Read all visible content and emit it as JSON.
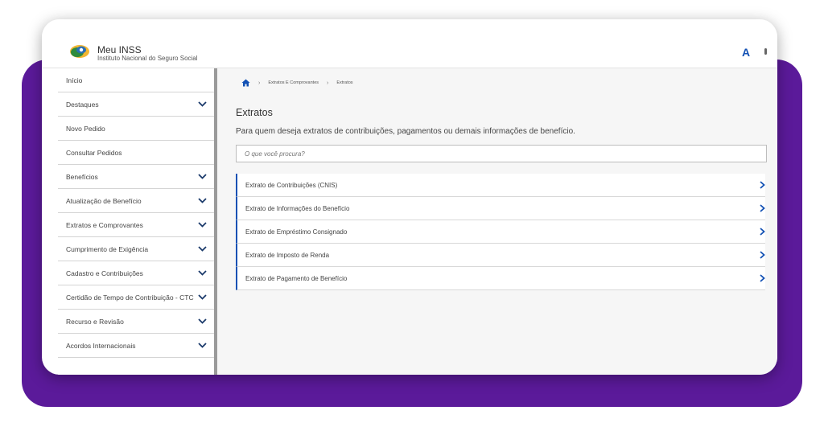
{
  "app": {
    "title": "Meu INSS",
    "subtitle": "Instituto Nacional do Seguro Social",
    "font_size_button": "A"
  },
  "colors": {
    "accent": "#1351b4",
    "frame_background": "#5b1a9a",
    "content_background": "#f6f6f6"
  },
  "sidebar": {
    "items": [
      {
        "label": "Início",
        "chevron": false
      },
      {
        "label": "Destaques",
        "chevron": true
      },
      {
        "label": "Novo Pedido",
        "chevron": false
      },
      {
        "label": "Consultar Pedidos",
        "chevron": false
      },
      {
        "label": "Benefícios",
        "chevron": true
      },
      {
        "label": "Atualização de Benefício",
        "chevron": true
      },
      {
        "label": "Extratos e Comprovantes",
        "chevron": true
      },
      {
        "label": "Cumprimento de Exigência",
        "chevron": true
      },
      {
        "label": "Cadastro e Contribuições",
        "chevron": true
      },
      {
        "label": "Certidão de Tempo de Contribuição - CTC",
        "chevron": true
      },
      {
        "label": "Recurso e Revisão",
        "chevron": true
      },
      {
        "label": "Acordos Internacionais",
        "chevron": true
      }
    ]
  },
  "breadcrumb": {
    "items": [
      "Extratos E Comprovantes",
      "Extratos"
    ]
  },
  "main": {
    "title": "Extratos",
    "description": "Para quem deseja extratos de contribuições, pagamentos ou demais informações de benefício.",
    "search_placeholder": "O que você procura?",
    "list": [
      "Extrato de Contribuições (CNIS)",
      "Extrato de Informações do Benefício",
      "Extrato de Empréstimo Consignado",
      "Extrato de Imposto de Renda",
      "Extrato de Pagamento de Benefício"
    ]
  }
}
